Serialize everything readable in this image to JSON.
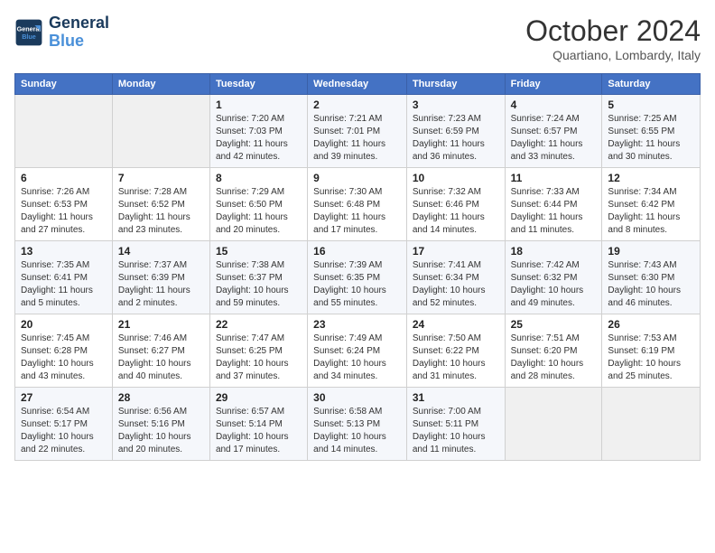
{
  "logo": {
    "line1": "General",
    "line2": "Blue"
  },
  "title": "October 2024",
  "location": "Quartiano, Lombardy, Italy",
  "weekdays": [
    "Sunday",
    "Monday",
    "Tuesday",
    "Wednesday",
    "Thursday",
    "Friday",
    "Saturday"
  ],
  "rows": [
    [
      {
        "day": "",
        "info": ""
      },
      {
        "day": "",
        "info": ""
      },
      {
        "day": "1",
        "info": "Sunrise: 7:20 AM\nSunset: 7:03 PM\nDaylight: 11 hours and 42 minutes."
      },
      {
        "day": "2",
        "info": "Sunrise: 7:21 AM\nSunset: 7:01 PM\nDaylight: 11 hours and 39 minutes."
      },
      {
        "day": "3",
        "info": "Sunrise: 7:23 AM\nSunset: 6:59 PM\nDaylight: 11 hours and 36 minutes."
      },
      {
        "day": "4",
        "info": "Sunrise: 7:24 AM\nSunset: 6:57 PM\nDaylight: 11 hours and 33 minutes."
      },
      {
        "day": "5",
        "info": "Sunrise: 7:25 AM\nSunset: 6:55 PM\nDaylight: 11 hours and 30 minutes."
      }
    ],
    [
      {
        "day": "6",
        "info": "Sunrise: 7:26 AM\nSunset: 6:53 PM\nDaylight: 11 hours and 27 minutes."
      },
      {
        "day": "7",
        "info": "Sunrise: 7:28 AM\nSunset: 6:52 PM\nDaylight: 11 hours and 23 minutes."
      },
      {
        "day": "8",
        "info": "Sunrise: 7:29 AM\nSunset: 6:50 PM\nDaylight: 11 hours and 20 minutes."
      },
      {
        "day": "9",
        "info": "Sunrise: 7:30 AM\nSunset: 6:48 PM\nDaylight: 11 hours and 17 minutes."
      },
      {
        "day": "10",
        "info": "Sunrise: 7:32 AM\nSunset: 6:46 PM\nDaylight: 11 hours and 14 minutes."
      },
      {
        "day": "11",
        "info": "Sunrise: 7:33 AM\nSunset: 6:44 PM\nDaylight: 11 hours and 11 minutes."
      },
      {
        "day": "12",
        "info": "Sunrise: 7:34 AM\nSunset: 6:42 PM\nDaylight: 11 hours and 8 minutes."
      }
    ],
    [
      {
        "day": "13",
        "info": "Sunrise: 7:35 AM\nSunset: 6:41 PM\nDaylight: 11 hours and 5 minutes."
      },
      {
        "day": "14",
        "info": "Sunrise: 7:37 AM\nSunset: 6:39 PM\nDaylight: 11 hours and 2 minutes."
      },
      {
        "day": "15",
        "info": "Sunrise: 7:38 AM\nSunset: 6:37 PM\nDaylight: 10 hours and 59 minutes."
      },
      {
        "day": "16",
        "info": "Sunrise: 7:39 AM\nSunset: 6:35 PM\nDaylight: 10 hours and 55 minutes."
      },
      {
        "day": "17",
        "info": "Sunrise: 7:41 AM\nSunset: 6:34 PM\nDaylight: 10 hours and 52 minutes."
      },
      {
        "day": "18",
        "info": "Sunrise: 7:42 AM\nSunset: 6:32 PM\nDaylight: 10 hours and 49 minutes."
      },
      {
        "day": "19",
        "info": "Sunrise: 7:43 AM\nSunset: 6:30 PM\nDaylight: 10 hours and 46 minutes."
      }
    ],
    [
      {
        "day": "20",
        "info": "Sunrise: 7:45 AM\nSunset: 6:28 PM\nDaylight: 10 hours and 43 minutes."
      },
      {
        "day": "21",
        "info": "Sunrise: 7:46 AM\nSunset: 6:27 PM\nDaylight: 10 hours and 40 minutes."
      },
      {
        "day": "22",
        "info": "Sunrise: 7:47 AM\nSunset: 6:25 PM\nDaylight: 10 hours and 37 minutes."
      },
      {
        "day": "23",
        "info": "Sunrise: 7:49 AM\nSunset: 6:24 PM\nDaylight: 10 hours and 34 minutes."
      },
      {
        "day": "24",
        "info": "Sunrise: 7:50 AM\nSunset: 6:22 PM\nDaylight: 10 hours and 31 minutes."
      },
      {
        "day": "25",
        "info": "Sunrise: 7:51 AM\nSunset: 6:20 PM\nDaylight: 10 hours and 28 minutes."
      },
      {
        "day": "26",
        "info": "Sunrise: 7:53 AM\nSunset: 6:19 PM\nDaylight: 10 hours and 25 minutes."
      }
    ],
    [
      {
        "day": "27",
        "info": "Sunrise: 6:54 AM\nSunset: 5:17 PM\nDaylight: 10 hours and 22 minutes."
      },
      {
        "day": "28",
        "info": "Sunrise: 6:56 AM\nSunset: 5:16 PM\nDaylight: 10 hours and 20 minutes."
      },
      {
        "day": "29",
        "info": "Sunrise: 6:57 AM\nSunset: 5:14 PM\nDaylight: 10 hours and 17 minutes."
      },
      {
        "day": "30",
        "info": "Sunrise: 6:58 AM\nSunset: 5:13 PM\nDaylight: 10 hours and 14 minutes."
      },
      {
        "day": "31",
        "info": "Sunrise: 7:00 AM\nSunset: 5:11 PM\nDaylight: 10 hours and 11 minutes."
      },
      {
        "day": "",
        "info": ""
      },
      {
        "day": "",
        "info": ""
      }
    ]
  ]
}
